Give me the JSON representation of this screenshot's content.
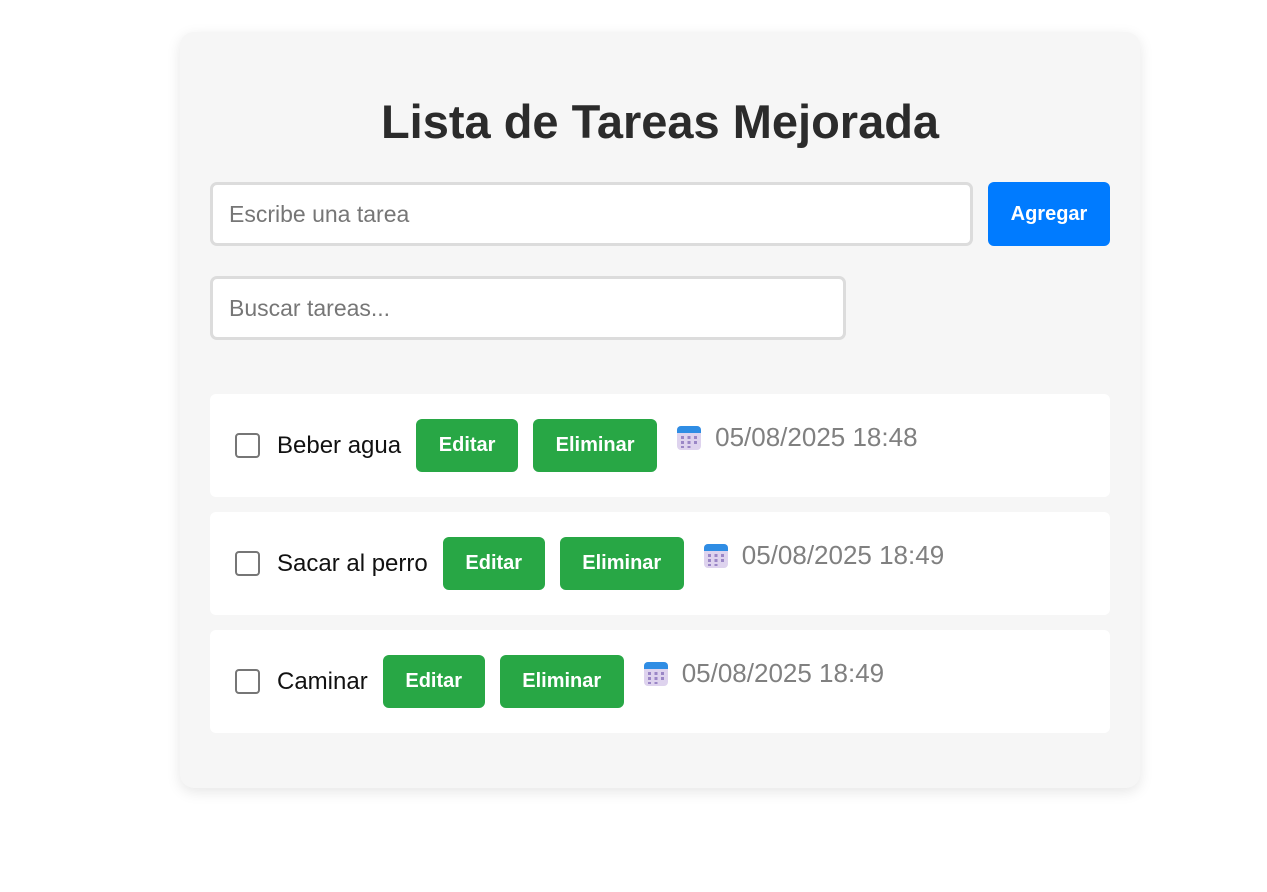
{
  "app": {
    "title": "Lista de Tareas Mejorada"
  },
  "new_task": {
    "value": "",
    "placeholder": "Escribe una tarea",
    "add_label": "Agregar"
  },
  "search": {
    "value": "",
    "placeholder": "Buscar tareas..."
  },
  "tasks": [
    {
      "text": "Beber agua",
      "checked": false,
      "edit_label": "Editar",
      "delete_label": "Eliminar",
      "date_icon": "calendar-icon",
      "date": "05/08/2025 18:48"
    },
    {
      "text": "Sacar al perro",
      "checked": false,
      "edit_label": "Editar",
      "delete_label": "Eliminar",
      "date_icon": "calendar-icon",
      "date": "05/08/2025 18:49"
    },
    {
      "text": "Caminar",
      "checked": false,
      "edit_label": "Editar",
      "delete_label": "Eliminar",
      "date_icon": "calendar-icon",
      "date": "05/08/2025 18:49"
    }
  ],
  "colors": {
    "primary": "#007bff",
    "success": "#28a745",
    "card_bg": "#f6f6f6",
    "date_text": "#808080"
  }
}
